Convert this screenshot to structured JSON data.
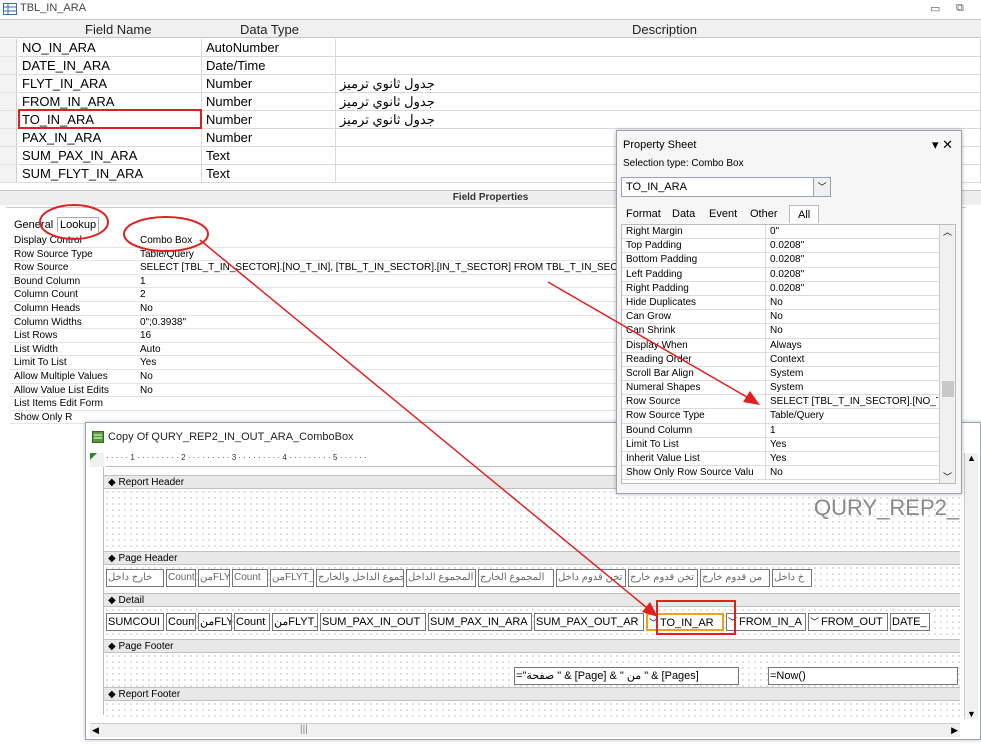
{
  "window": {
    "title": "TBL_IN_ARA"
  },
  "grid": {
    "headers": [
      "Field Name",
      "Data Type",
      "Description"
    ],
    "rows": [
      {
        "field": "NO_IN_ARA",
        "type": "AutoNumber",
        "desc": ""
      },
      {
        "field": "DATE_IN_ARA",
        "type": "Date/Time",
        "desc": ""
      },
      {
        "field": "FLYT_IN_ARA",
        "type": "Number",
        "desc": "جدول ثانوي ترميز"
      },
      {
        "field": "FROM_IN_ARA",
        "type": "Number",
        "desc": "جدول ثانوي ترميز"
      },
      {
        "field": "TO_IN_ARA",
        "type": "Number",
        "desc": "جدول ثانوي ترميز"
      },
      {
        "field": "PAX_IN_ARA",
        "type": "Number",
        "desc": ""
      },
      {
        "field": "SUM_PAX_IN_ARA",
        "type": "Text",
        "desc": ""
      },
      {
        "field": "SUM_FLYT_IN_ARA",
        "type": "Text",
        "desc": ""
      }
    ]
  },
  "field_props": {
    "bar_label": "Field Properties",
    "tab_general": "General",
    "tab_lookup": "Lookup",
    "rows": [
      {
        "k": "Display Control",
        "v": "Combo Box"
      },
      {
        "k": "Row Source Type",
        "v": "Table/Query"
      },
      {
        "k": "Row Source",
        "v": "SELECT [TBL_T_IN_SECTOR].[NO_T_IN], [TBL_T_IN_SECTOR].[IN_T_SECTOR] FROM TBL_T_IN_SECTOR;"
      },
      {
        "k": "Bound Column",
        "v": "1"
      },
      {
        "k": "Column Count",
        "v": "2"
      },
      {
        "k": "Column Heads",
        "v": "No"
      },
      {
        "k": "Column Widths",
        "v": "0\";0.3938\""
      },
      {
        "k": "List Rows",
        "v": "16"
      },
      {
        "k": "List Width",
        "v": "Auto"
      },
      {
        "k": "Limit To List",
        "v": "Yes"
      },
      {
        "k": "Allow Multiple Values",
        "v": "No"
      },
      {
        "k": "Allow Value List Edits",
        "v": "No"
      },
      {
        "k": "List Items Edit Form",
        "v": ""
      },
      {
        "k": "Show Only R",
        "v": ""
      }
    ]
  },
  "property_sheet": {
    "title": "Property Sheet",
    "selection": "Selection type:  Combo Box",
    "combo_value": "TO_IN_ARA",
    "tabs": [
      "Format",
      "Data",
      "Event",
      "Other",
      "All"
    ],
    "rows": [
      {
        "k": "Right Margin",
        "v": "0\""
      },
      {
        "k": "Top Padding",
        "v": "0.0208\""
      },
      {
        "k": "Bottom Padding",
        "v": "0.0208\""
      },
      {
        "k": "Left Padding",
        "v": "0.0208\""
      },
      {
        "k": "Right Padding",
        "v": "0.0208\""
      },
      {
        "k": "Hide Duplicates",
        "v": "No"
      },
      {
        "k": "Can Grow",
        "v": "No"
      },
      {
        "k": "Can Shrink",
        "v": "No"
      },
      {
        "k": "Display When",
        "v": "Always"
      },
      {
        "k": "Reading Order",
        "v": "Context"
      },
      {
        "k": "Scroll Bar Align",
        "v": "System"
      },
      {
        "k": "Numeral Shapes",
        "v": "System"
      },
      {
        "k": "Row Source",
        "v": "SELECT [TBL_T_IN_SECTOR].[NO_T_I"
      },
      {
        "k": "Row Source Type",
        "v": "Table/Query"
      },
      {
        "k": "Bound Column",
        "v": "1"
      },
      {
        "k": "Limit To List",
        "v": "Yes"
      },
      {
        "k": "Inherit Value List",
        "v": "Yes"
      },
      {
        "k": "Show Only Row Source Valu",
        "v": "No"
      }
    ]
  },
  "report": {
    "title": "Copy Of QURY_REP2_IN_OUT_ARA_ComboBox",
    "ruler": "·  ·  ·  ·  ·  1  ·  ·  ·  ·  ·  ·  ·  ·  ·  2  ·  ·  ·  ·  ·  ·  ·  ·  ·  3  ·  ·  ·  ·  ·  ·  ·  ·  ·  4  ·  ·  ·  ·  ·  ·  ·  ·  ·  5  ·  ·  ·  ·  ·  ·",
    "sections": {
      "report_header": "Report Header",
      "page_header": "Page Header",
      "detail": "Detail",
      "page_footer": "Page Footer",
      "report_footer": "Report Footer"
    },
    "header_title": "QURY_REP2_",
    "page_header_labels": [
      "خارج داخل",
      "Count",
      "منFLYT",
      "Count",
      "منFLYT_",
      "مجموع الداخل والخارج",
      "المجموع الداخل",
      "المجموع الخارج",
      "تخن قدوم داخل",
      "تخن قدوم خارج",
      "من قدوم خارج",
      "خ داخل"
    ],
    "detail_fields": [
      "SUMCOUI",
      "Count",
      "منFLYT",
      "Count",
      "منFLYT_",
      "SUM_PAX_IN_OUT",
      "SUM_PAX_IN_ARA",
      "SUM_PAX_OUT_AR",
      "TO_IN_AR",
      "FROM_IN_A",
      "FROM_OUT",
      "DATE_"
    ],
    "footer_page": "=\"صفحة \" & [Page] & \" من \" & [Pages]",
    "footer_now": "=Now()"
  }
}
